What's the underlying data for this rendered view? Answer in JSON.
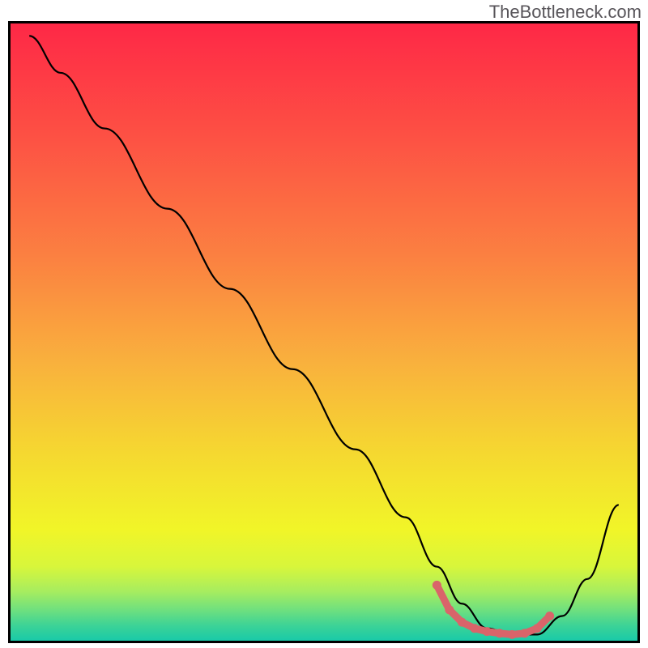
{
  "watermark": "TheBottleneck.com",
  "chart_data": {
    "type": "line",
    "title": "",
    "xlabel": "",
    "ylabel": "",
    "xlim": [
      0,
      100
    ],
    "ylim": [
      0,
      100
    ],
    "series": [
      {
        "name": "bottleneck-curve",
        "color": "#000000",
        "x": [
          3,
          8,
          15,
          25,
          35,
          45,
          55,
          63,
          68,
          72,
          76,
          80,
          84,
          88,
          92,
          97
        ],
        "y": [
          98,
          92,
          83,
          70,
          57,
          44,
          31,
          20,
          12,
          6,
          2,
          1,
          1,
          4,
          10,
          22
        ]
      }
    ],
    "highlight": {
      "color": "#d9646a",
      "points_x": [
        68,
        70,
        72,
        74,
        76,
        78,
        80,
        82,
        84,
        86
      ],
      "points_y": [
        9,
        5,
        3,
        2,
        1.5,
        1.2,
        1,
        1.2,
        2,
        4
      ]
    },
    "gradient_stops": [
      {
        "offset": 0.0,
        "color": "#fe2846"
      },
      {
        "offset": 0.18,
        "color": "#fd5044"
      },
      {
        "offset": 0.38,
        "color": "#fb8141"
      },
      {
        "offset": 0.55,
        "color": "#f9b13d"
      },
      {
        "offset": 0.7,
        "color": "#f5d930"
      },
      {
        "offset": 0.82,
        "color": "#f1f528"
      },
      {
        "offset": 0.88,
        "color": "#d8f63b"
      },
      {
        "offset": 0.92,
        "color": "#a7ed5f"
      },
      {
        "offset": 0.95,
        "color": "#6fe07e"
      },
      {
        "offset": 0.975,
        "color": "#3dd396"
      },
      {
        "offset": 1.0,
        "color": "#19caa8"
      }
    ]
  }
}
